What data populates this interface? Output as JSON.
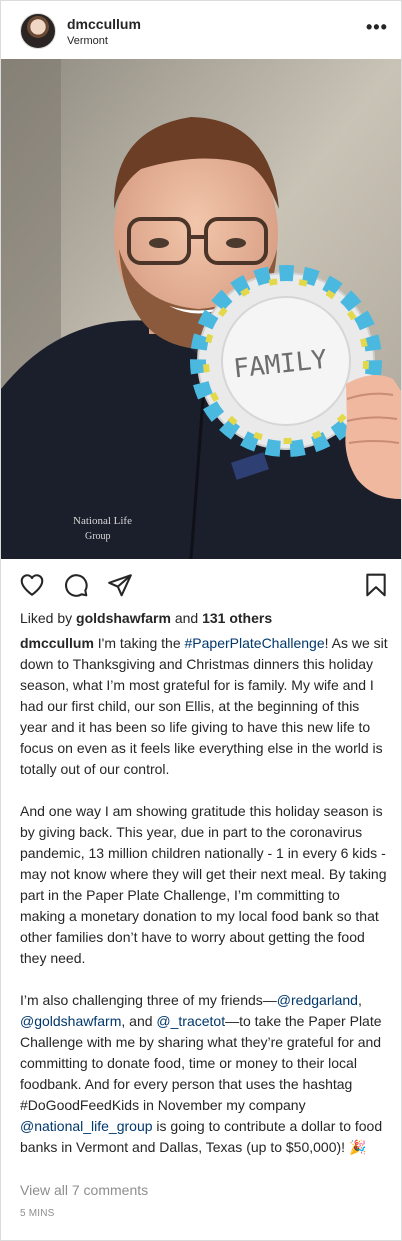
{
  "header": {
    "username": "dmccullum",
    "location": "Vermont",
    "more_label": "•••"
  },
  "post_image": {
    "plate_text": "FAMILY"
  },
  "actions": {
    "icons": [
      "heart-icon",
      "comment-icon",
      "share-icon",
      "bookmark-icon"
    ]
  },
  "likes": {
    "prefix": "Liked by",
    "user": "goldshawfarm",
    "joiner": "and",
    "others": "131 others"
  },
  "caption": {
    "p1": {
      "user": "dmccullum",
      "t1": " I'm taking the ",
      "tag1": "#PaperPlateChallenge",
      "t2": "! As we sit down to Thanksgiving and Christmas dinners this holiday season, what I’m most grateful for is family. My wife and I had our first child, our son Ellis, at the beginning of this year and it has been so life giving to have this new life to focus on even as it feels like everything else in the world is totally out of our control."
    },
    "p2": "And one way I am showing gratitude this holiday season is by giving back. This year, due in part to the coronavirus pandemic, 13 million children nationally - 1 in every 6 kids - may not know where they will get their next meal. By taking part in the Paper Plate Challenge, I’m committing to making a monetary donation to my local food bank so that other families don’t have to worry about getting the food they need.",
    "p3": {
      "t1": "I’m also challenging three of my friends—",
      "m1": "@redgarland",
      "t2": ", ",
      "m2": "@goldshawfarm",
      "t3": ", and ",
      "m3": "@_tracetot",
      "t4": "—to take the Paper Plate Challenge with me by sharing what they’re grateful for and committing to donate food, time or money to their local foodbank. And for every person that uses the hashtag #DoGoodFeedKids in November my company ",
      "m4": "@national_life_group",
      "t5": " is going to contribute a dollar to food banks in Vermont and Dallas, Texas (up to $50,000)! 🎉"
    }
  },
  "comments_link": "View all 7 comments",
  "timestamp": "5 MINS"
}
